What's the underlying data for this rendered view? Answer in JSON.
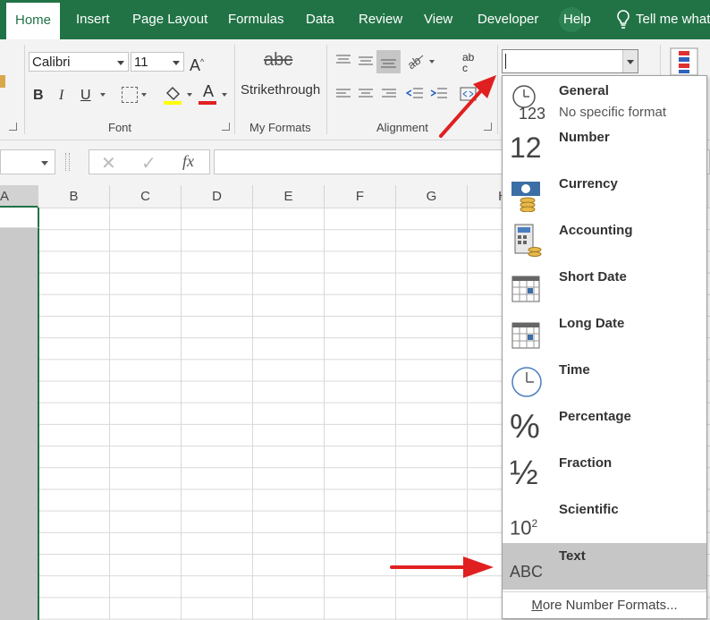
{
  "tabs": {
    "home": "Home",
    "insert": "Insert",
    "page_layout": "Page Layout",
    "formulas": "Formulas",
    "data": "Data",
    "review": "Review",
    "view": "View",
    "developer": "Developer",
    "help": "Help",
    "tell_me": "Tell me what"
  },
  "font": {
    "name": "Calibri",
    "size": "11",
    "group_label": "Font",
    "bold": "B",
    "italic": "I",
    "underline": "U",
    "font_color_glyph": "A"
  },
  "my_formats": {
    "sample": "abc",
    "strikethrough": "Strikethrough",
    "group_label": "My Formats"
  },
  "alignment": {
    "group_label": "Alignment",
    "wrap_glyph_top": "ab",
    "wrap_glyph_bottom": "c"
  },
  "number_format": {
    "current_value": ""
  },
  "formula_bar": {
    "fx": "fx",
    "cancel": "✕",
    "enter": "✓"
  },
  "columns": [
    "A",
    "B",
    "C",
    "D",
    "E",
    "F",
    "G",
    "H"
  ],
  "dropdown": {
    "items": [
      {
        "name": "General",
        "sub": "No specific format",
        "icon": "clock-123-icon"
      },
      {
        "name": "Number",
        "icon": "number-12-icon",
        "glyph": "12"
      },
      {
        "name": "Currency",
        "icon": "currency-icon"
      },
      {
        "name": "Accounting",
        "icon": "accounting-icon"
      },
      {
        "name": "Short Date",
        "icon": "calendar-icon"
      },
      {
        "name": "Long Date",
        "icon": "calendar-icon"
      },
      {
        "name": "Time",
        "icon": "clock-icon"
      },
      {
        "name": "Percentage",
        "icon": "percent-icon",
        "glyph": "%"
      },
      {
        "name": "Fraction",
        "icon": "fraction-icon",
        "glyph": "½"
      },
      {
        "name": "Scientific",
        "icon": "scientific-icon",
        "glyph": "10",
        "glyph_exp": "2"
      },
      {
        "name": "Text",
        "icon": "text-abc-icon",
        "glyph": "ABC",
        "selected": true
      }
    ],
    "general_glyph": "123",
    "more": "More Number Formats..."
  },
  "colors": {
    "excel_green": "#217346",
    "arrow_red": "#e02020",
    "selection_gray": "#c6c6c6"
  }
}
